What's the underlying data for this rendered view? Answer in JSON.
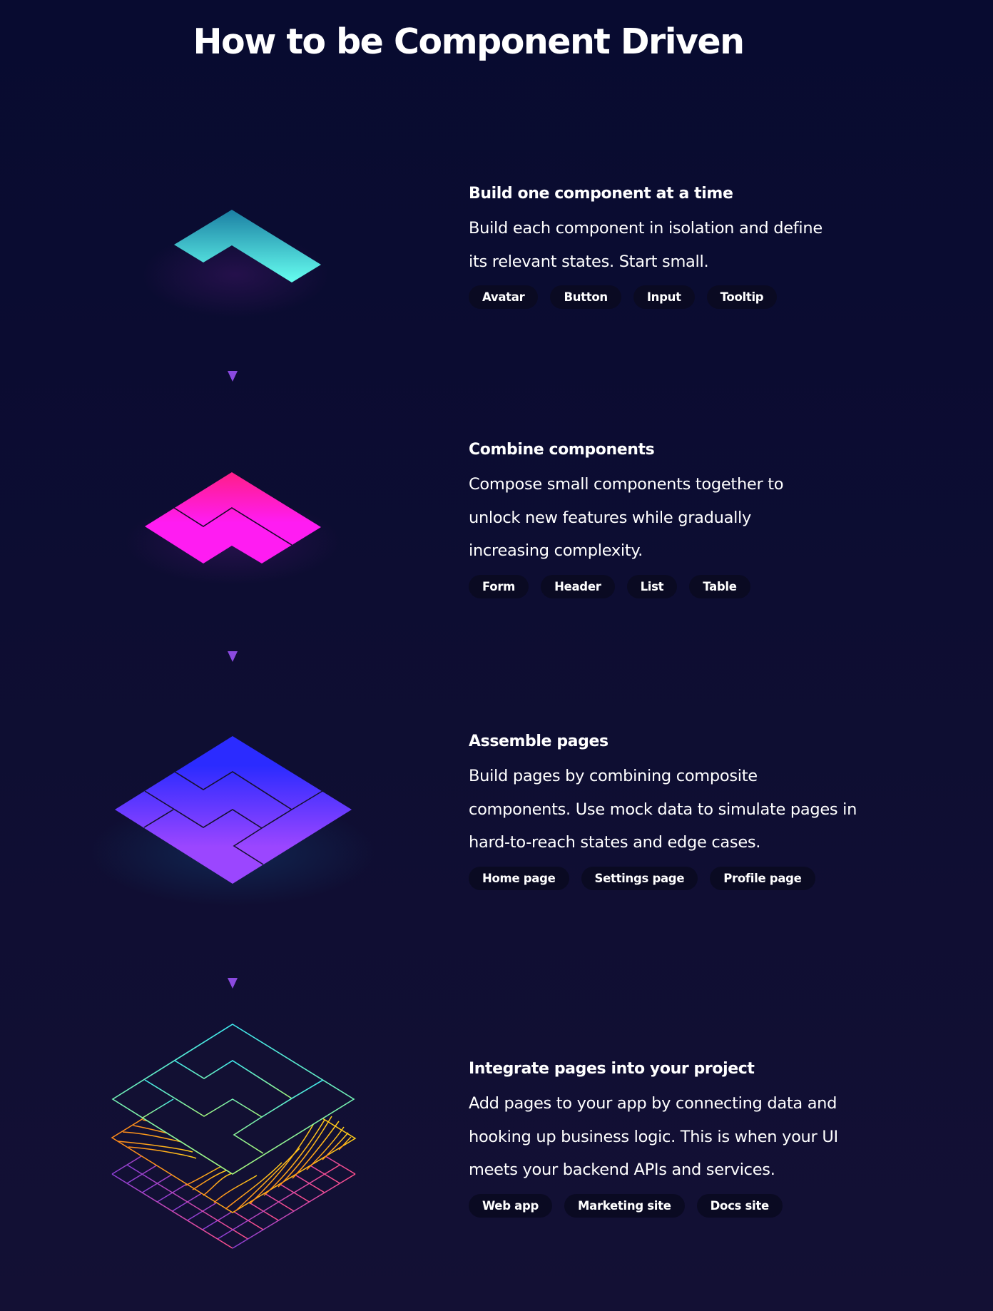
{
  "page": {
    "title": "How to be Component Driven"
  },
  "steps": [
    {
      "heading": "Build one component at a time",
      "body": "Build each component in isolation and define its relevant states. Start small.",
      "tags": [
        "Avatar",
        "Button",
        "Input",
        "Tooltip"
      ],
      "icon": "single-component-shape-icon",
      "colors": [
        "#1b7fa3",
        "#66fff0"
      ]
    },
    {
      "heading": "Combine components",
      "body": "Compose small components together to unlock new features while gradually increasing complexity.",
      "tags": [
        "Form",
        "Header",
        "List",
        "Table"
      ],
      "icon": "combined-components-shape-icon",
      "colors": [
        "#ff1e88",
        "#ff1cf2"
      ]
    },
    {
      "heading": "Assemble pages",
      "body": "Build pages by combining composite components. Use mock data to simulate pages in hard-to-reach states and edge cases.",
      "tags": [
        "Home page",
        "Settings page",
        "Profile page"
      ],
      "icon": "assembled-page-shape-icon",
      "colors": [
        "#2b2bff",
        "#9b46ff"
      ]
    },
    {
      "heading": "Integrate pages into your project",
      "body": "Add pages to your app by connecting data and hooking up business logic. This is when your UI meets your backend APIs and services.",
      "tags": [
        "Web app",
        "Marketing site",
        "Docs site"
      ],
      "icon": "integrated-layers-icon",
      "colors": [
        "#3ee8ee",
        "#a6f77a",
        "#ff8a1a",
        "#ffcc1a",
        "#8c3fd6",
        "#ff4f8b"
      ]
    }
  ],
  "arrow_colors": [
    "#e0457b",
    "#8b4ae0"
  ]
}
